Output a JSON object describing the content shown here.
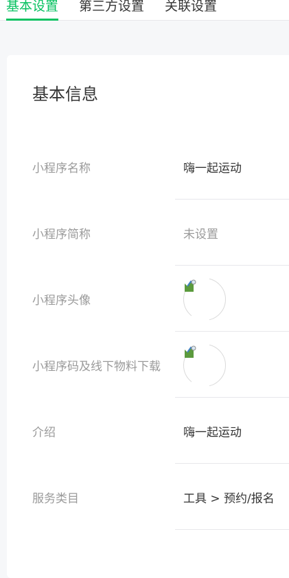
{
  "tabs": [
    {
      "label": "基本设置",
      "active": true
    },
    {
      "label": "第三方设置",
      "active": false
    },
    {
      "label": "关联设置",
      "active": false
    }
  ],
  "card": {
    "title": "基本信息",
    "rows": [
      {
        "label": "小程序名称",
        "value": "嗨一起运动",
        "type": "text"
      },
      {
        "label": "小程序简称",
        "value": "未设置",
        "type": "muted"
      },
      {
        "label": "小程序头像",
        "type": "image"
      },
      {
        "label": "小程序码及线下物料下载",
        "type": "image"
      },
      {
        "label": "介绍",
        "value": "嗨一起运动",
        "type": "text"
      },
      {
        "label": "服务类目",
        "value": "工具 > 预约/报名",
        "type": "text"
      }
    ]
  },
  "colors": {
    "accent": "#07c160",
    "label": "#9a9a9a",
    "text": "#353535",
    "divider": "#e7e7eb"
  },
  "icons": {
    "broken_image": "broken-image-icon"
  }
}
